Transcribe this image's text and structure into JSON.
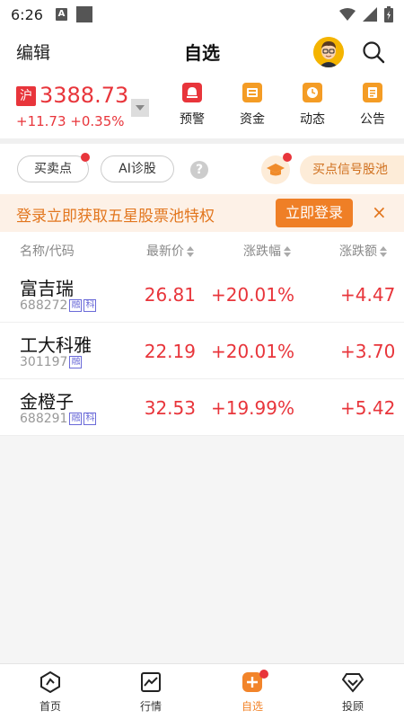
{
  "status_bar": {
    "time": "6:26",
    "notif_icon_letter": "A"
  },
  "header": {
    "edit_label": "编辑",
    "title": "自选"
  },
  "index": {
    "market_tag": "沪",
    "price": "3388.73",
    "change": "+11.73",
    "change_pct": "+0.35%",
    "quick_actions": [
      {
        "label": "预警",
        "icon": "alert-icon"
      },
      {
        "label": "资金",
        "icon": "funds-icon"
      },
      {
        "label": "动态",
        "icon": "clock-icon"
      },
      {
        "label": "公告",
        "icon": "notice-icon"
      }
    ]
  },
  "filters": {
    "buy_sell_label": "买卖点",
    "ai_label": "AI诊股",
    "help_label": "?",
    "signal_pool_label": "买点信号股池"
  },
  "banner": {
    "text": "登录立即获取五星股票池特权",
    "button_label": "立即登录",
    "close_label": "×"
  },
  "table": {
    "headers": {
      "name_code": "名称/代码",
      "latest_price": "最新价",
      "change_pct": "涨跌幅",
      "change_amt": "涨跌额"
    },
    "rows": [
      {
        "name": "富吉瑞",
        "code": "688272",
        "tags": [
          "融",
          "科"
        ],
        "price": "26.81",
        "change_pct": "+20.01%",
        "change_amt": "+4.47"
      },
      {
        "name": "工大科雅",
        "code": "301197",
        "tags": [
          "融"
        ],
        "price": "22.19",
        "change_pct": "+20.01%",
        "change_amt": "+3.70"
      },
      {
        "name": "金橙子",
        "code": "688291",
        "tags": [
          "融",
          "科"
        ],
        "price": "32.53",
        "change_pct": "+19.99%",
        "change_amt": "+5.42"
      }
    ]
  },
  "bottom_nav": [
    {
      "label": "首页",
      "icon": "home-icon"
    },
    {
      "label": "行情",
      "icon": "chart-icon"
    },
    {
      "label": "自选",
      "icon": "plus-icon"
    },
    {
      "label": "投顾",
      "icon": "diamond-icon"
    }
  ],
  "colors": {
    "up_red": "#e8353b",
    "accent_orange": "#ef7f26",
    "banner_bg": "#fdf1e7"
  }
}
